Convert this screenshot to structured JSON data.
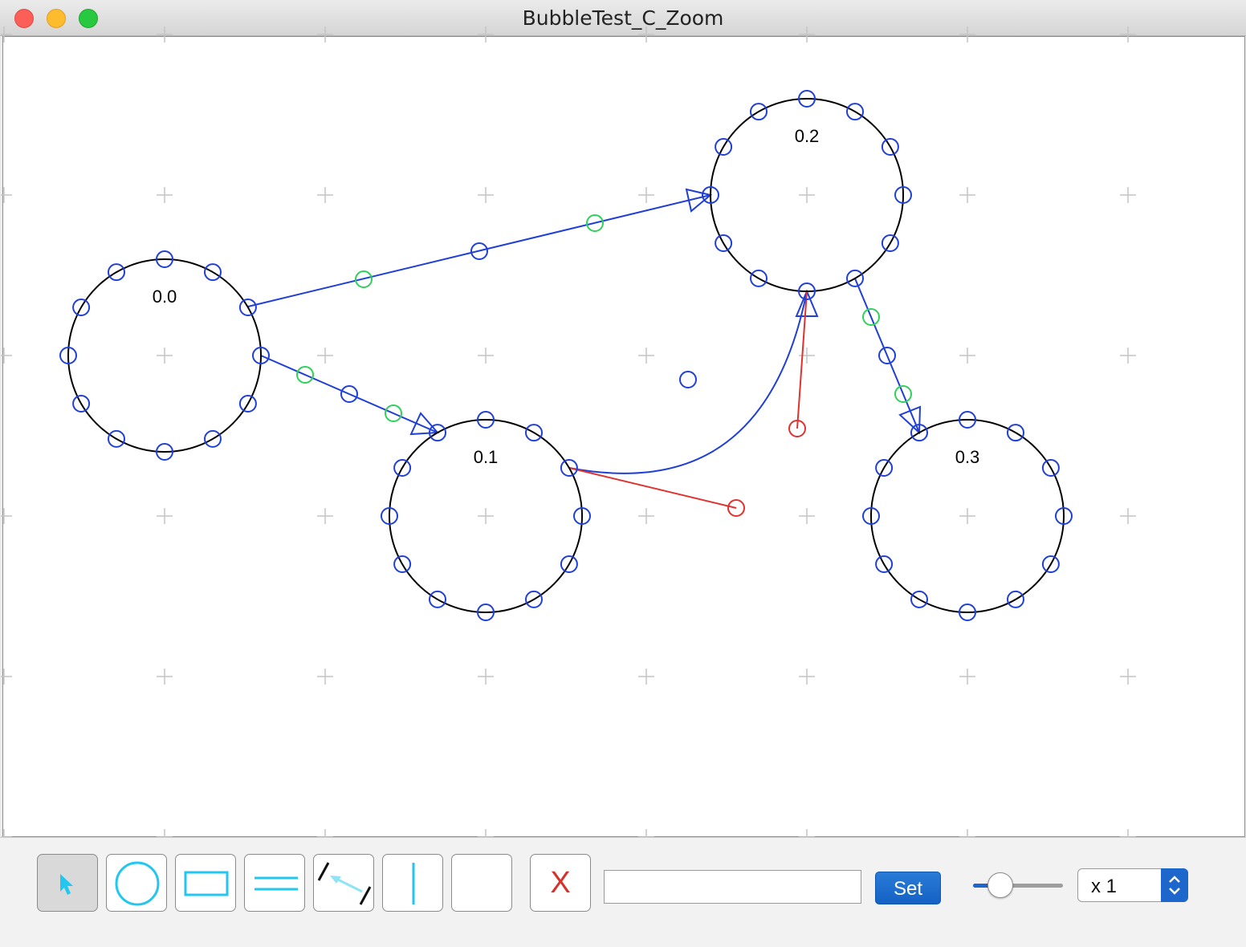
{
  "window": {
    "title": "BubbleTest_C_Zoom"
  },
  "bubbles": [
    {
      "label": "0.0"
    },
    {
      "label": "0.1"
    },
    {
      "label": "0.2"
    },
    {
      "label": "0.3"
    }
  ],
  "toolbar": {
    "tools": [
      {
        "name": "select-tool",
        "icon": "arrow-cursor-icon",
        "selected": true
      },
      {
        "name": "circle-tool",
        "icon": "circle-icon",
        "selected": false
      },
      {
        "name": "rectangle-tool",
        "icon": "rectangle-icon",
        "selected": false
      },
      {
        "name": "double-line-tool",
        "icon": "double-line-icon",
        "selected": false
      },
      {
        "name": "connector-tool",
        "icon": "connector-arrow-icon",
        "selected": false
      },
      {
        "name": "vertical-line-tool",
        "icon": "vertical-line-icon",
        "selected": false
      },
      {
        "name": "blank-tool",
        "icon": "",
        "selected": false
      }
    ],
    "delete_label": "X",
    "text_value": "",
    "set_label": "Set",
    "zoom_slider": 0.3,
    "zoom_value": "x 1"
  },
  "colors": {
    "blue": "#1f3fd6",
    "green": "#2fd15a",
    "red": "#e0322e",
    "accent": "#1c66cc",
    "tool_cyan": "#22c6ee"
  }
}
